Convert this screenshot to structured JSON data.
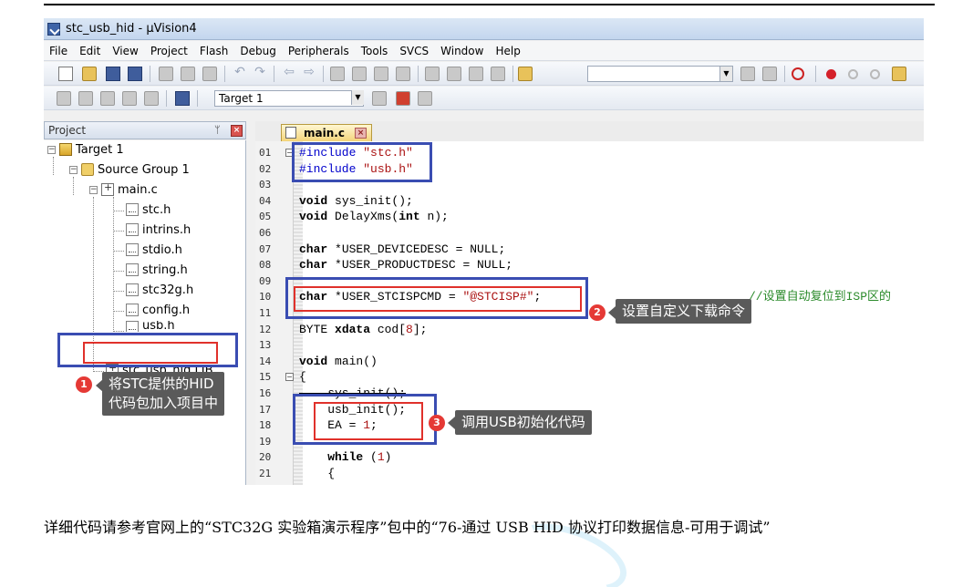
{
  "window": {
    "title": "stc_usb_hid  - µVision4"
  },
  "menu": [
    "File",
    "Edit",
    "View",
    "Project",
    "Flash",
    "Debug",
    "Peripherals",
    "Tools",
    "SVCS",
    "Window",
    "Help"
  ],
  "toolbar": {
    "target_select": "Target 1"
  },
  "project_panel": {
    "title": "Project",
    "tree": {
      "target": "Target 1",
      "group": "Source Group 1",
      "main_file": "main.c",
      "headers": [
        "stc.h",
        "intrins.h",
        "stdio.h",
        "string.h",
        "stc32g.h",
        "config.h",
        "usb.h"
      ],
      "lib_file": "stc_usb_hid.LIB"
    }
  },
  "editor": {
    "tab_label": "main.c",
    "lines": [
      {
        "n": "01",
        "fold": "−"
      },
      {
        "n": "02"
      },
      {
        "n": "03"
      },
      {
        "n": "04"
      },
      {
        "n": "05"
      },
      {
        "n": "06"
      },
      {
        "n": "07"
      },
      {
        "n": "08"
      },
      {
        "n": "09"
      },
      {
        "n": "10"
      },
      {
        "n": "11"
      },
      {
        "n": "12"
      },
      {
        "n": "13"
      },
      {
        "n": "14"
      },
      {
        "n": "15",
        "fold": "−"
      },
      {
        "n": "16"
      },
      {
        "n": "17"
      },
      {
        "n": "18"
      },
      {
        "n": "19"
      },
      {
        "n": "20"
      },
      {
        "n": "21"
      }
    ],
    "code": {
      "l01a": "#include",
      "l01b": "\"stc.h\"",
      "l02a": "#include",
      "l02b": "\"usb.h\"",
      "l04a": "void",
      "l04b": " sys_init();",
      "l05a": "void",
      "l05b": " DelayXms(",
      "l05c": "int",
      "l05d": " n);",
      "l07a": "char",
      "l07b": " *USER_DEVICEDESC = NULL;",
      "l08a": "char",
      "l08b": " *USER_PRODUCTDESC = NULL;",
      "l10a": "char",
      "l10b": " *USER_STCISPCMD = ",
      "l10c": "\"@STCISP#\"",
      "l10d": ";",
      "l10_comment": "//设置自动复位到ISP区的",
      "l12a": "BYTE ",
      "l12b": "xdata",
      "l12c": " cod[",
      "l12d": "8",
      "l12e": "];",
      "l14a": "void",
      "l14b": " main()",
      "l15": "{",
      "l16": "    sys_init();",
      "l17": "    usb_init();",
      "l18a": "    EA = ",
      "l18b": "1",
      "l18c": ";",
      "l20a": "    while",
      "l20b": " (",
      "l20c": "1",
      "l20d": ")",
      "l21": "    {"
    }
  },
  "annotations": {
    "a1": {
      "num": "1",
      "text_line1": "将STC提供的HID",
      "text_line2": "代码包加入项目中"
    },
    "a2": {
      "num": "2",
      "text": "设置自定义下载命令"
    },
    "a3": {
      "num": "3",
      "text": "调用USB初始化代码"
    }
  },
  "caption": "详细代码请参考官网上的“STC32G 实验箱演示程序”包中的“76-通过 USB HID 协议打印数据信息-可用于调试”",
  "colors": {
    "annotation_box_blue": "#3a4db2",
    "annotation_box_red": "#e0312b",
    "callout_bg": "#5a5a5a",
    "callout_dot": "#e53935"
  }
}
